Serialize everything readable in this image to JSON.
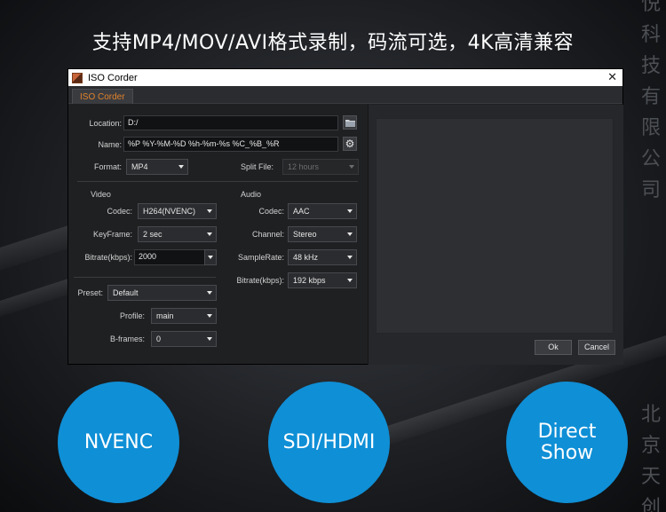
{
  "headline": "支持MP4/MOV/AVI格式录制，码流可选，4K高清兼容",
  "side_text_top": [
    "悦",
    "科",
    "技",
    "有",
    "限",
    "公",
    "司"
  ],
  "side_text_bottom": [
    "北",
    "京",
    "天",
    "创"
  ],
  "window": {
    "title": "ISO Corder",
    "close_glyph": "✕",
    "tab": "ISO Corder",
    "location": {
      "label": "Location:",
      "value": "D:/"
    },
    "name": {
      "label": "Name:",
      "value": "%P %Y-%M-%D %h-%m-%s %C_%B_%R"
    },
    "format": {
      "label": "Format:",
      "value": "MP4"
    },
    "split_file": {
      "label": "Split File:",
      "value": "12 hours"
    },
    "video": {
      "heading": "Video",
      "codec": {
        "label": "Codec:",
        "value": "H264(NVENC)"
      },
      "keyframe": {
        "label": "KeyFrame:",
        "value": "2 sec"
      },
      "bitrate": {
        "label": "Bitrate(kbps):",
        "value": "2000"
      }
    },
    "audio": {
      "heading": "Audio",
      "codec": {
        "label": "Codec:",
        "value": "AAC"
      },
      "channel": {
        "label": "Channel:",
        "value": "Stereo"
      },
      "samplerate": {
        "label": "SampleRate:",
        "value": "48 kHz"
      },
      "bitrate": {
        "label": "Bitrate(kbps):",
        "value": "192 kbps"
      }
    },
    "preset": {
      "label": "Preset:",
      "value": "Default"
    },
    "profile": {
      "label": "Profile:",
      "value": "main"
    },
    "bframes": {
      "label": "B-frames:",
      "value": "0"
    },
    "ok_label": "Ok",
    "cancel_label": "Cancel"
  },
  "badges": {
    "left": "NVENC",
    "middle": "SDI/HDMI",
    "right_line1": "Direct",
    "right_line2": "Show"
  },
  "colors": {
    "badge": "#0f8fd6",
    "tab_text": "#e0822b"
  }
}
